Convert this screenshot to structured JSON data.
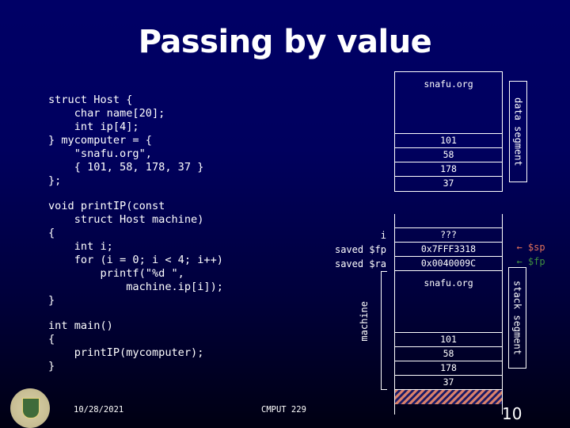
{
  "slide": {
    "title": "Passing by value",
    "code_struct": "struct Host {\n    char name[20];\n    int ip[4];\n} mycomputer = {\n    \"snafu.org\",\n    { 101, 58, 178, 37 }\n};",
    "code_printip": "void printIP(const\n    struct Host machine)\n{\n    int i;\n    for (i = 0; i < 4; i++)\n        printf(\"%d \",\n            machine.ip[i]);\n}",
    "code_main": "int main()\n{\n    printIP(mycomputer);\n}"
  },
  "data_segment": {
    "label": "data segment",
    "name_cell": "snafu.org",
    "ip_cells": [
      "101",
      "58",
      "178",
      "37"
    ]
  },
  "stack_segment": {
    "label": "stack segment",
    "rows": [
      {
        "label": "i",
        "value": "???"
      },
      {
        "label": "saved $fp",
        "value": "0x7FFF3318"
      },
      {
        "label": "saved $ra",
        "value": "0x0040009C"
      }
    ],
    "machine_label": "machine",
    "name_cell": "snafu.org",
    "ip_cells": [
      "101",
      "58",
      "178",
      "37"
    ]
  },
  "pointers": {
    "sp": {
      "text": "← $sp",
      "color": "#e0705a"
    },
    "fp": {
      "text": "← $fp",
      "color": "#3f8f3f"
    }
  },
  "footer": {
    "date": "10/28/2021",
    "course": "CMPUT 229",
    "page_number": "10"
  },
  "colors": {
    "hatch_a": "#d9806a",
    "hatch_b": "#1a1a66"
  }
}
